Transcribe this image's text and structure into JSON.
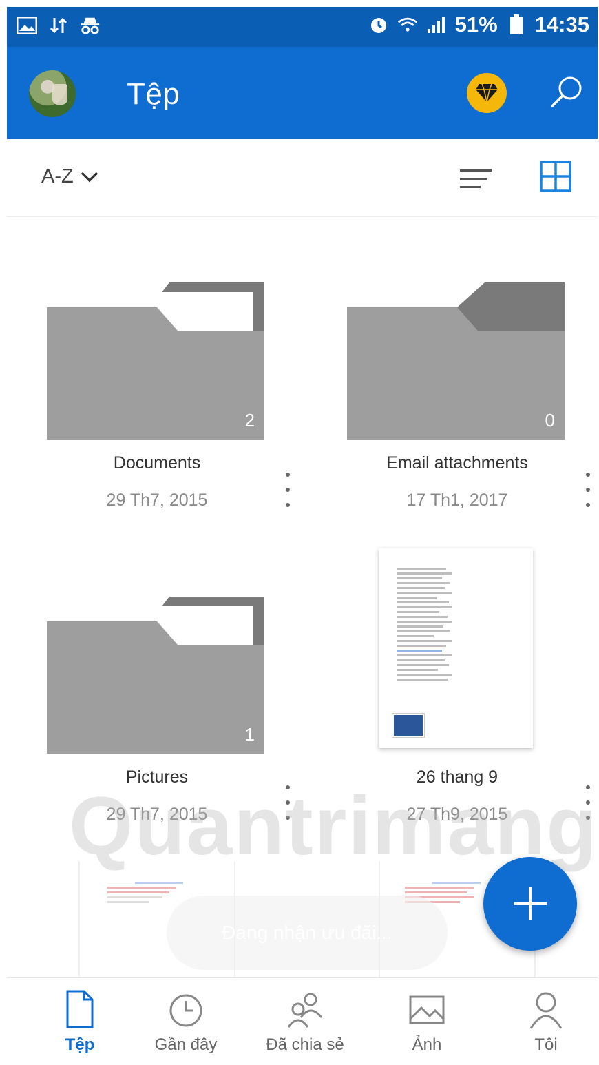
{
  "status_bar": {
    "battery": "51%",
    "time": "14:35"
  },
  "header": {
    "title": "Tệp"
  },
  "toolbar": {
    "sort_label": "A-Z"
  },
  "items": [
    {
      "name": "Documents",
      "date": "29 Th7, 2015",
      "type": "folder",
      "count": "2"
    },
    {
      "name": "Email attachments",
      "date": "17 Th1, 2017",
      "type": "folder",
      "count": "0"
    },
    {
      "name": "Pictures",
      "date": "29 Th7, 2015",
      "type": "folder",
      "count": "1"
    },
    {
      "name": "26 thang 9",
      "date": "27 Th9, 2015",
      "type": "word-document"
    }
  ],
  "toast": "Đang nhận ưu đãi...",
  "watermark": "Quantrimang",
  "bottom_nav": [
    {
      "label": "Tệp",
      "icon": "file-icon",
      "active": true
    },
    {
      "label": "Gần đây",
      "icon": "clock-icon",
      "active": false
    },
    {
      "label": "Đã chia sẻ",
      "icon": "people-icon",
      "active": false
    },
    {
      "label": "Ảnh",
      "icon": "image-icon",
      "active": false
    },
    {
      "label": "Tôi",
      "icon": "person-icon",
      "active": false
    }
  ],
  "colors": {
    "status_bar": "#0a5fb4",
    "app_bar": "#0f6cd0",
    "accent": "#0f6cd0",
    "premium": "#f5b80a",
    "folder": "#9e9e9e"
  }
}
